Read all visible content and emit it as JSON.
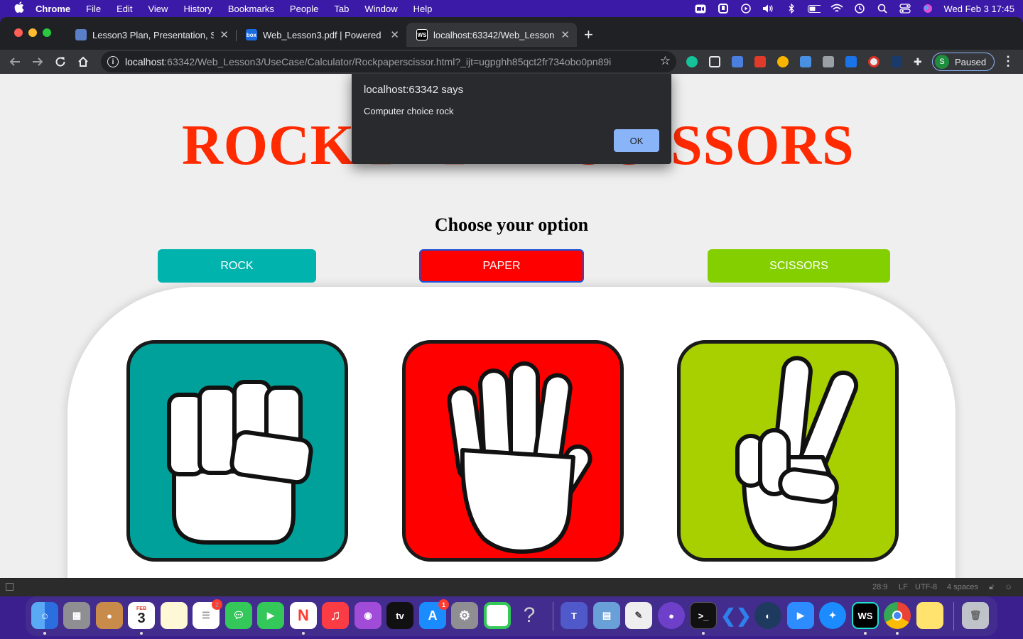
{
  "menubar": {
    "apple": "",
    "items": [
      "Chrome",
      "File",
      "Edit",
      "View",
      "History",
      "Bookmarks",
      "People",
      "Tab",
      "Window",
      "Help"
    ],
    "clock": "Wed Feb 3  17:45"
  },
  "tabs": [
    {
      "title": "Lesson3 Plan, Presentation, Sc",
      "close": "✕",
      "favicon_color": "#5b7fc7"
    },
    {
      "title": "Web_Lesson3.pdf | Powered by",
      "close": "✕",
      "favicon_color": "#1a6be0",
      "favicon_text": "box"
    },
    {
      "title": "localhost:63342/Web_Lesson3",
      "close": "✕",
      "favicon_text": "WS",
      "active": true
    }
  ],
  "newtab": "+",
  "omnibox": {
    "host": "localhost",
    "path": ":63342/Web_Lesson3/UseCase/Calculator/Rockpaperscissor.html?_ijt=ugpghh85qct2fr734obo0pn89i"
  },
  "profile": {
    "initial": "S",
    "label": "Paused"
  },
  "page": {
    "title": "ROCK PAPER SCISSORS",
    "subtitle": "Choose your option",
    "buttons": [
      {
        "label": "ROCK",
        "color": "#00b3ad"
      },
      {
        "label": "PAPER",
        "color": "#ff0000"
      },
      {
        "label": "SCISSORS",
        "color": "#84cf00"
      }
    ],
    "cards": [
      {
        "name": "rock",
        "color": "#00a19b"
      },
      {
        "name": "paper",
        "color": "#ff0000"
      },
      {
        "name": "scissors",
        "color": "#a8d000"
      }
    ]
  },
  "alert": {
    "title": "localhost:63342 says",
    "message": "Computer choice rock",
    "ok": "OK"
  },
  "idebar": {
    "position": "28:9",
    "line_ending": "LF",
    "encoding": "UTF-8",
    "indent": "4 spaces"
  },
  "dock": {
    "calendar_month": "FEB",
    "calendar_day": "3",
    "reminders_badge": "2",
    "appstore_badge": "1",
    "tv_label": "tv",
    "ws_label": "WS"
  }
}
